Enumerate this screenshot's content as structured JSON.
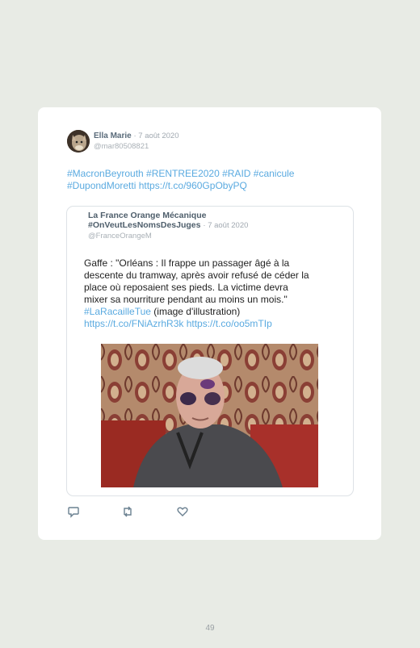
{
  "tweet": {
    "author_name": "Ella Marie",
    "date": "· 7 août 2020",
    "handle": "@mar80508821",
    "text_line1": "#MacronBeyrouth #RENTREE2020 #RAID #canicule",
    "text_line2": "#DupondMoretti https://t.co/960GpObyPQ"
  },
  "quoted_tweet": {
    "author_name": "La France Orange Mécanique",
    "author_tag": "#OnVeutLesNomsDesJuges",
    "date": "· 7 août 2020",
    "handle": "@FranceOrangeM",
    "line1": "Gaffe : \"Orléans : Il frappe un passager âgé à la",
    "line2": "descente du tramway, après avoir refusé de céder la",
    "line3": "place où reposaient ses pieds. La victime devra",
    "line4": "mixer sa nourriture pendant au moins un mois.\"",
    "hashtag": "#LaRacailleTue",
    "hashtag_suffix": " (image d'illustration)",
    "links": "https://t.co/FNiAzrhR3k https://t.co/oo5mTIp"
  },
  "actions": [
    {
      "icon": "reply-icon"
    },
    {
      "icon": "retweet-icon"
    },
    {
      "icon": "like-icon"
    }
  ],
  "page_number": "49",
  "colors": {
    "background": "#e8ebe5",
    "link": "#5aaae0",
    "name": "#4e5e6b"
  }
}
